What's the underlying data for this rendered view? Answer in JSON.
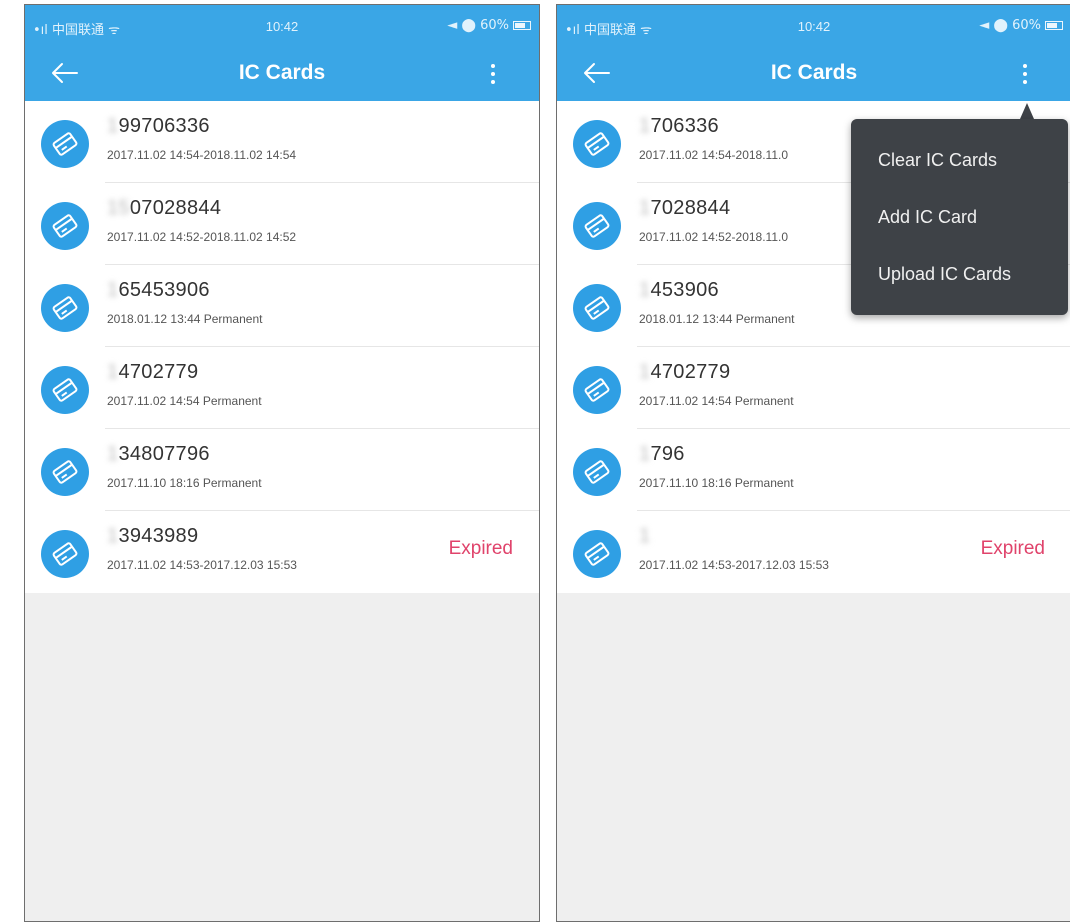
{
  "status_bar": {
    "carrier": "•ıl 中国联通 ᯤ",
    "time": "10:42",
    "battery": "◄ ⬤ 60%"
  },
  "nav": {
    "title": "IC Cards"
  },
  "left_screen": {
    "cards": [
      {
        "number_hidden": "1",
        "number_visible": "99706336",
        "validity": "2017.11.02 14:54-2018.11.02 14:54",
        "status": ""
      },
      {
        "number_hidden": "15",
        "number_visible": "07028844",
        "validity": "2017.11.02 14:52-2018.11.02 14:52",
        "status": ""
      },
      {
        "number_hidden": "1",
        "number_visible": "65453906",
        "validity": "2018.01.12 13:44   Permanent",
        "status": ""
      },
      {
        "number_hidden": "1",
        "number_visible": "4702779",
        "validity": "2017.11.02 14:54   Permanent",
        "status": ""
      },
      {
        "number_hidden": "1",
        "number_visible": "34807796",
        "validity": "2017.11.10 18:16   Permanent",
        "status": ""
      },
      {
        "number_hidden": "1",
        "number_visible": "3943989",
        "validity": "2017.11.02 14:53-2017.12.03 15:53",
        "status": "Expired"
      }
    ]
  },
  "right_screen": {
    "cards": [
      {
        "number_hidden": "1",
        "number_visible": "706336",
        "validity": "2017.11.02 14:54-2018.11.0",
        "status": ""
      },
      {
        "number_hidden": "1",
        "number_visible": "7028844",
        "validity": "2017.11.02 14:52-2018.11.0",
        "status": ""
      },
      {
        "number_hidden": "1",
        "number_visible": "453906",
        "validity": "2018.01.12 13:44   Permanent",
        "status": ""
      },
      {
        "number_hidden": "1",
        "number_visible": "4702779",
        "validity": "2017.11.02 14:54   Permanent",
        "status": ""
      },
      {
        "number_hidden": "1",
        "number_visible": "796",
        "validity": "2017.11.10 18:16   Permanent",
        "status": ""
      },
      {
        "number_hidden": "1",
        "number_visible": "",
        "validity": "2017.11.02 14:53-2017.12.03 15:53",
        "status": "Expired"
      }
    ],
    "menu": {
      "items": [
        "Clear IC Cards",
        "Add IC Card",
        "Upload IC Cards"
      ]
    }
  },
  "colors": {
    "accent": "#3aa6e6",
    "card_icon": "#2f9fe4",
    "expired": "#e0436b",
    "menu_bg": "#3e4247",
    "background": "#efefef"
  },
  "icons": {
    "back": "arrow-left-icon",
    "more": "more-vertical-icon",
    "card": "ic-card-icon"
  }
}
